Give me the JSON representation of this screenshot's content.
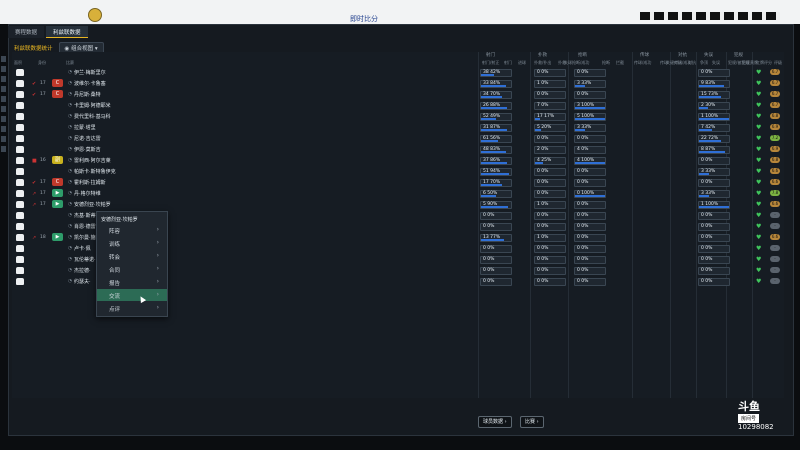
{
  "window": {
    "title": "即时比分"
  },
  "tabs": [
    {
      "label": "赛程数据"
    },
    {
      "label": "利兹联数据"
    }
  ],
  "subbar": {
    "label": "利兹联数据统计",
    "dropdown": "组合视图"
  },
  "groups": [
    "射门",
    "扑救",
    "抢断",
    "传球",
    "对抗",
    "失误",
    "犯规"
  ],
  "columns": [
    "面积",
    "身份",
    "比赛",
    "射门/射正",
    "射门",
    "进球",
    "扑救/扑出",
    "扑救",
    "失球",
    "抢断/成功",
    "抢断",
    "拦截",
    "传球/成功",
    "传球",
    "关键传球",
    "对抗/成功",
    "对抗",
    "争顶",
    "失误",
    "犯规/被犯规",
    "犯规",
    "黄牌",
    "红牌",
    "评分",
    "评级"
  ],
  "players": [
    {
      "name": "伊兰·梅斯里尔",
      "badge": "",
      "badge_color": "",
      "lvl": "",
      "mark": "",
      "b1": "38 42%",
      "b2": "0 0%",
      "b3": "0 0%",
      "b4": "0 0%",
      "heart": "♥",
      "rating": "6.7",
      "rating_color": "#b7863a"
    },
    {
      "name": "波维尔·卡鲁塞",
      "badge": "C",
      "badge_color": "#c0392b",
      "lvl": "17",
      "mark": "✔",
      "b1": "33 84%",
      "b2": "1 0%",
      "b3": "3 33%",
      "b4": "9 83%",
      "heart": "♥",
      "rating": "6.7",
      "rating_color": "#b7863a"
    },
    {
      "name": "丹尼斯·桑特",
      "badge": "C",
      "badge_color": "#c0392b",
      "lvl": "17",
      "mark": "✔",
      "b1": "34 70%",
      "b2": "0 0%",
      "b3": "0 0%",
      "b4": "15 73%",
      "heart": "♥",
      "rating": "6.7",
      "rating_color": "#b7863a"
    },
    {
      "name": "卡里姆·阿德耶米",
      "badge": "",
      "badge_color": "",
      "lvl": "",
      "mark": "",
      "b1": "26 88%",
      "b2": "7 0%",
      "b3": "3 100%",
      "b4": "2 30%",
      "heart": "♥",
      "rating": "6.7",
      "rating_color": "#b7863a"
    },
    {
      "name": "费代里科·基马科",
      "badge": "",
      "badge_color": "",
      "lvl": "",
      "mark": "",
      "b1": "52 49%",
      "b2": "17 17%",
      "b3": "5 100%",
      "b4": "1 100%",
      "heart": "♥",
      "rating": "6.8",
      "rating_color": "#b7863a"
    },
    {
      "name": "拉蒙·塔里",
      "badge": "",
      "badge_color": "",
      "lvl": "",
      "mark": "",
      "b1": "31 87%",
      "b2": "5 20%",
      "b3": "3 33%",
      "b4": "7 42%",
      "heart": "♥",
      "rating": "6.9",
      "rating_color": "#b7863a"
    },
    {
      "name": "尼诺·吉达雷",
      "badge": "",
      "badge_color": "",
      "lvl": "",
      "mark": "",
      "b1": "61 56%",
      "b2": "0 0%",
      "b3": "0 0%",
      "b4": "22 72%",
      "heart": "♥",
      "rating": "7.2",
      "rating_color": "#7cb342"
    },
    {
      "name": "伊恩·莫斯吉",
      "badge": "",
      "badge_color": "",
      "lvl": "",
      "mark": "",
      "b1": "48 83%",
      "b2": "2 0%",
      "b3": "4 0%",
      "b4": "8 87%",
      "heart": "♥",
      "rating": "6.9",
      "rating_color": "#b7863a"
    },
    {
      "name": "雷利西·阿尔吉莱",
      "badge": "副",
      "badge_color": "#c9b21e",
      "lvl": "16",
      "mark": "■",
      "b1": "37 86%",
      "b2": "4 25%",
      "b3": "4 100%",
      "b4": "0 0%",
      "heart": "♥",
      "rating": "6.8",
      "rating_color": "#b7863a"
    },
    {
      "name": "帕斯卡·斯特鲁伊克",
      "badge": "",
      "badge_color": "",
      "lvl": "",
      "mark": "",
      "b1": "51 94%",
      "b2": "0 0%",
      "b3": "0 0%",
      "b4": "3 33%",
      "heart": "♥",
      "rating": "6.6",
      "rating_color": "#b7863a"
    },
    {
      "name": "霍利斯·拉姆斯",
      "badge": "C",
      "badge_color": "#c0392b",
      "lvl": "17",
      "mark": "✔",
      "b1": "17 70%",
      "b2": "0 0%",
      "b3": "0 0%",
      "b4": "0 0%",
      "heart": "♥",
      "rating": "6.6",
      "rating_color": "#b7863a"
    },
    {
      "name": "丹·格尔特维",
      "badge": "▶",
      "badge_color": "#2e9c6a",
      "lvl": "17",
      "mark": "↗",
      "b1": "6 50%",
      "b2": "0 0%",
      "b3": "0 100%",
      "b4": "3 33%",
      "heart": "♥",
      "rating": "7.8",
      "rating_color": "#7cb342"
    },
    {
      "name": "安德烈亚·坎帕罗",
      "badge": "▶",
      "badge_color": "#2e9c6a",
      "lvl": "17",
      "mark": "↗",
      "b1": "5 90%",
      "b2": "1 0%",
      "b3": "0 0%",
      "b4": "1 100%",
      "heart": "♥",
      "rating": "6.6",
      "rating_color": "#b7863a"
    },
    {
      "name": "杰基·斯蒂",
      "badge": "",
      "badge_color": "",
      "lvl": "",
      "mark": "",
      "b1": "0 0%",
      "b2": "0 0%",
      "b3": "0 0%",
      "b4": "0 0%",
      "heart": "♥",
      "rating": "-",
      "rating_color": "#5a636d"
    },
    {
      "name": "肖恩·德雷",
      "badge": "",
      "badge_color": "",
      "lvl": "",
      "mark": "",
      "b1": "0 0%",
      "b2": "0 0%",
      "b3": "0 0%",
      "b4": "0 0%",
      "heart": "♥",
      "rating": "-",
      "rating_color": "#5a636d"
    },
    {
      "name": "凯尔曼·施",
      "badge": "▶",
      "badge_color": "#2e9c6a",
      "lvl": "18",
      "mark": "↗",
      "b1": "13 77%",
      "b2": "1 0%",
      "b3": "0 0%",
      "b4": "0 0%",
      "heart": "♥",
      "rating": "6.6",
      "rating_color": "#b7863a"
    },
    {
      "name": "卢卡·佩",
      "badge": "",
      "badge_color": "",
      "lvl": "",
      "mark": "",
      "b1": "0 0%",
      "b2": "0 0%",
      "b3": "0 0%",
      "b4": "0 0%",
      "heart": "♥",
      "rating": "-",
      "rating_color": "#5a636d"
    },
    {
      "name": "瓦伦蒂诺·",
      "badge": "",
      "badge_color": "",
      "lvl": "",
      "mark": "",
      "b1": "0 0%",
      "b2": "0 0%",
      "b3": "0 0%",
      "b4": "0 0%",
      "heart": "♥",
      "rating": "-",
      "rating_color": "#5a636d"
    },
    {
      "name": "杰拉德·",
      "badge": "",
      "badge_color": "",
      "lvl": "",
      "mark": "",
      "b1": "0 0%",
      "b2": "0 0%",
      "b3": "0 0%",
      "b4": "0 0%",
      "heart": "♥",
      "rating": "-",
      "rating_color": "#5a636d"
    },
    {
      "name": "约瑟夫·",
      "badge": "",
      "badge_color": "",
      "lvl": "",
      "mark": "",
      "b1": "0 0%",
      "b2": "0 0%",
      "b3": "0 0%",
      "b4": "0 0%",
      "heart": "♥",
      "rating": "-",
      "rating_color": "#5a636d"
    }
  ],
  "context_menu": {
    "header": "安德烈亚·坎帕罗",
    "items": [
      {
        "label": "阵容"
      },
      {
        "label": "训练"
      },
      {
        "label": "转会"
      },
      {
        "label": "合同"
      },
      {
        "label": "报告"
      },
      {
        "label": "交流"
      },
      {
        "label": "点评"
      }
    ],
    "active_index": 5
  },
  "buttons": {
    "match_data": "球员数据 ›",
    "compare": "比赛 ›"
  },
  "watermark": {
    "brand": "斗鱼",
    "tag": "房间号",
    "room": "10298082"
  }
}
